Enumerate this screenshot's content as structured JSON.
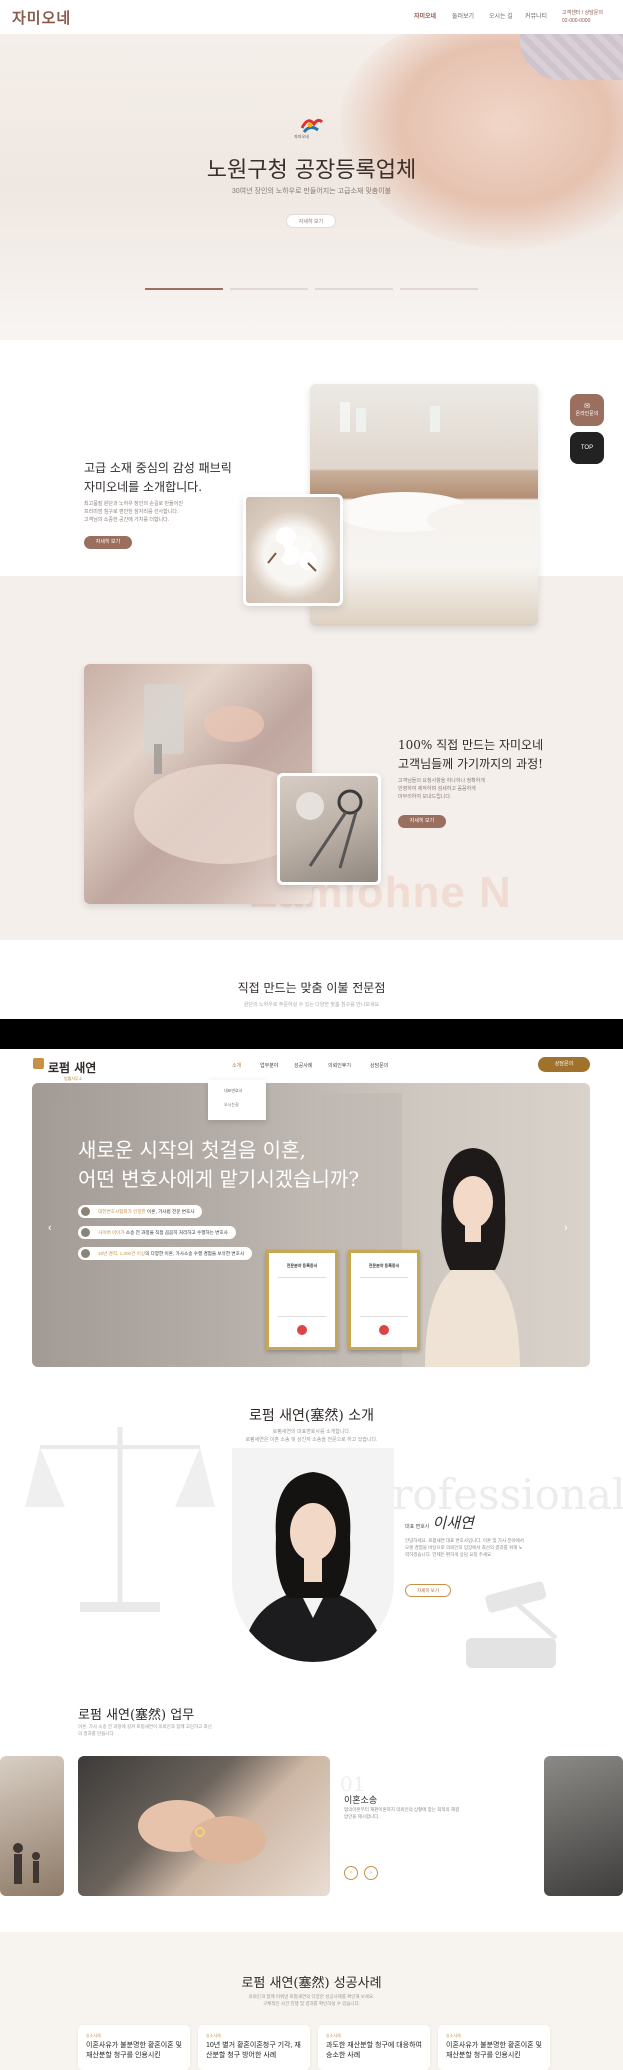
{
  "site1": {
    "logo": "자미오네",
    "nav": [
      "자미오네",
      "둘러보기",
      "오시는 길",
      "커뮤니티"
    ],
    "phone_label": "고객센터 / 상담문의",
    "phone": "02-000-0000",
    "hero": {
      "emblem_label": "자미오네",
      "title": "노원구청 공장등록업체",
      "subtitle": "30여년 장인의 노하우로 만들어지는 고급소재 맞춤이불",
      "button": "자세히 보기"
    },
    "intro": {
      "heading_line1": "고급 소재 중심의 감성 패브릭",
      "heading_line2": "자미오네를 소개합니다.",
      "desc1": "최고품질 원단과 노하우 장인의 손길로 만들어진",
      "desc2": "프리미엄 침구로 편안한 잠자리를 선사합니다.",
      "desc3": "고객님의 소중한 공간에 가치를 더합니다.",
      "button": "자세히 보기"
    },
    "process": {
      "heading_line1": "100% 직접 만드는 자미오네",
      "heading_line2": "고객님들께 가기까지의 과정!",
      "desc1": "고객님들의 요청사항을 하나하나 정확하게",
      "desc2": "반영하여 제작하며 섬세하고 꼼꼼하게",
      "desc3": "마무리하여 보내드립니다.",
      "button": "자세히 보기",
      "watermark": "Zamiohne N"
    },
    "floating": {
      "consult": "온라인문의",
      "top": "TOP"
    },
    "section3": {
      "title": "직접 만드는 맞춤 이불 전문점",
      "subtitle": "원단의 노하우로 주문하실 수 있는 다양한 맞춤 침구를 만나보세요"
    }
  },
  "site2": {
    "logo": "로펌 새연",
    "logo_tag": "법률사무소",
    "nav": [
      "소개",
      "업무분야",
      "성공사례",
      "의뢰인후기",
      "상담문의"
    ],
    "consult_button": "상담문의",
    "dropdown": [
      "대표변호사",
      "오시는길"
    ],
    "hero": {
      "line1": "새로운 시작의 첫걸음 이혼,",
      "line2": "어떤 변호사에게 맡기시겠습니까?",
      "checks": [
        {
          "em": "대한변호사협회가 인정한",
          "rest": " 이혼, 가사법 전문 변호사"
        },
        {
          "em": "사이버 아이가",
          "rest": " 소송 전 과정을 직접 꼼꼼히 처리하고 수행하는 변호사"
        },
        {
          "em": "10년 경력, 1,000건 이상",
          "rest": "의 다양한 이혼, 가사소송 수행 경험을 보유한 변호사"
        }
      ],
      "cert_title": "전문분야 등록증서"
    },
    "about": {
      "title": "로펌 새연(塞然) 소개",
      "sub1": "로펌새연의 대표변호사를 소개합니다.",
      "sub2": "로펌새연은 이혼 소송 및 상간자 소송을 전문으로 하고 있습니다.",
      "watermark": "Professional",
      "role": "대표 변호사",
      "signature": "이새연",
      "desc": "안녕하세요. 로펌새연 대표 변호사입니다. 이혼 및 가사 분야에서 오랜 경험을 바탕으로 의뢰인의 입장에서 최선의 결과를 위해 노력하겠습니다. 언제든 편하게 상담 요청 주세요.",
      "button": "자세히 보기"
    },
    "work": {
      "title": "로펌 새연(塞然) 업무",
      "sub": "이혼, 가사 소송 전 과정에 걸쳐 로펌새연이 의뢰인과 함께 고민하고 최선의 결과를 만듭니다.",
      "num": "01",
      "item": "이혼소송",
      "desc": "협의이혼부터 재판이혼까지 의뢰인의 상황에 맞는 최적의 해결 방안을 제시합니다.",
      "prev": "‹",
      "next": "›"
    },
    "cases": {
      "title": "로펌 새연(塞然) 성공사례",
      "sub1": "의뢰인과 함께 이뤄낸 로펌새연의 다양한 성공사례를 확인해 보세요.",
      "sub2": "구체적인 사건 진행 및 결과를 확인하실 수 있습니다.",
      "items": [
        {
          "tag": "승소사례",
          "title": "이혼사유가 불분명한 황혼이혼 및 재산분할 청구를 인용시킨"
        },
        {
          "tag": "승소사례",
          "title": "10년 별거 황혼이혼청구 기각, 재산분할 청구 방어한 사례"
        },
        {
          "tag": "승소사례",
          "title": "과도한 재산분할 청구에 대응하여 승소한 사례"
        },
        {
          "tag": "승소사례",
          "title": "이혼사유가 불분명한 황혼이혼 및 재산분할 청구를 인용시킨"
        }
      ]
    }
  }
}
